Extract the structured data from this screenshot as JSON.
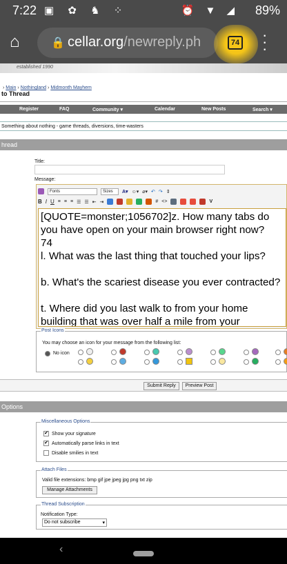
{
  "status": {
    "time": "7:22",
    "battery": "89%",
    "notif_icons": [
      "calendar-icon",
      "pinwheel-icon",
      "squirrel-icon",
      "dots-icon"
    ],
    "right_icons": [
      "alarm-icon",
      "wifi-icon",
      "signal-icon"
    ]
  },
  "browser": {
    "url_host": "cellar.org",
    "url_path": "/newreply.ph",
    "tab_count": "74"
  },
  "banner": {
    "est": "established 1990"
  },
  "breadcrumb": {
    "parts": [
      "Main",
      "Nothingland",
      "Midmonth Mayhem"
    ],
    "title": "to Thread"
  },
  "navbar": {
    "items": [
      "Register",
      "FAQ",
      "Community ▾",
      "Calendar",
      "New Posts",
      "Search ▾"
    ]
  },
  "forum": {
    "description": "Something about nothing - game threads, diversions, time-wasters"
  },
  "reply": {
    "section_title": "hread",
    "title_label": "Title:",
    "message_label": "Message:",
    "font_label": "Fonts",
    "size_label": "Sizes",
    "message_text": "[QUOTE=monster;1056702]z. How many tabs do you have open on your main browser right now?\n74\nl. What was the last thing that touched your lips?\n\nb. What's the scariest disease you ever contracted?\n\nt. Where did you last walk to from your home building that was over half a mile from your"
  },
  "post_icons": {
    "legend": "Post Icons",
    "instruction": "You may choose an icon for your message from the following list:",
    "no_icon": "No icon"
  },
  "buttons": {
    "submit": "Submit Reply",
    "preview": "Preview Post"
  },
  "options": {
    "section_title": "Options",
    "misc_legend": "Miscellaneous Options",
    "show_signature": "Show your signature",
    "parse_links": "Automatically parse links in text",
    "disable_smilies": "Disable smilies in text",
    "attach_legend": "Attach Files",
    "extensions": "Valid file extensions: bmp gif jpe jpeg jpg png txt zip",
    "manage_attachments": "Manage Attachments",
    "subscription_legend": "Thread Subscription",
    "notification_label": "Notification Type:",
    "notification_value": "Do not subscribe"
  }
}
